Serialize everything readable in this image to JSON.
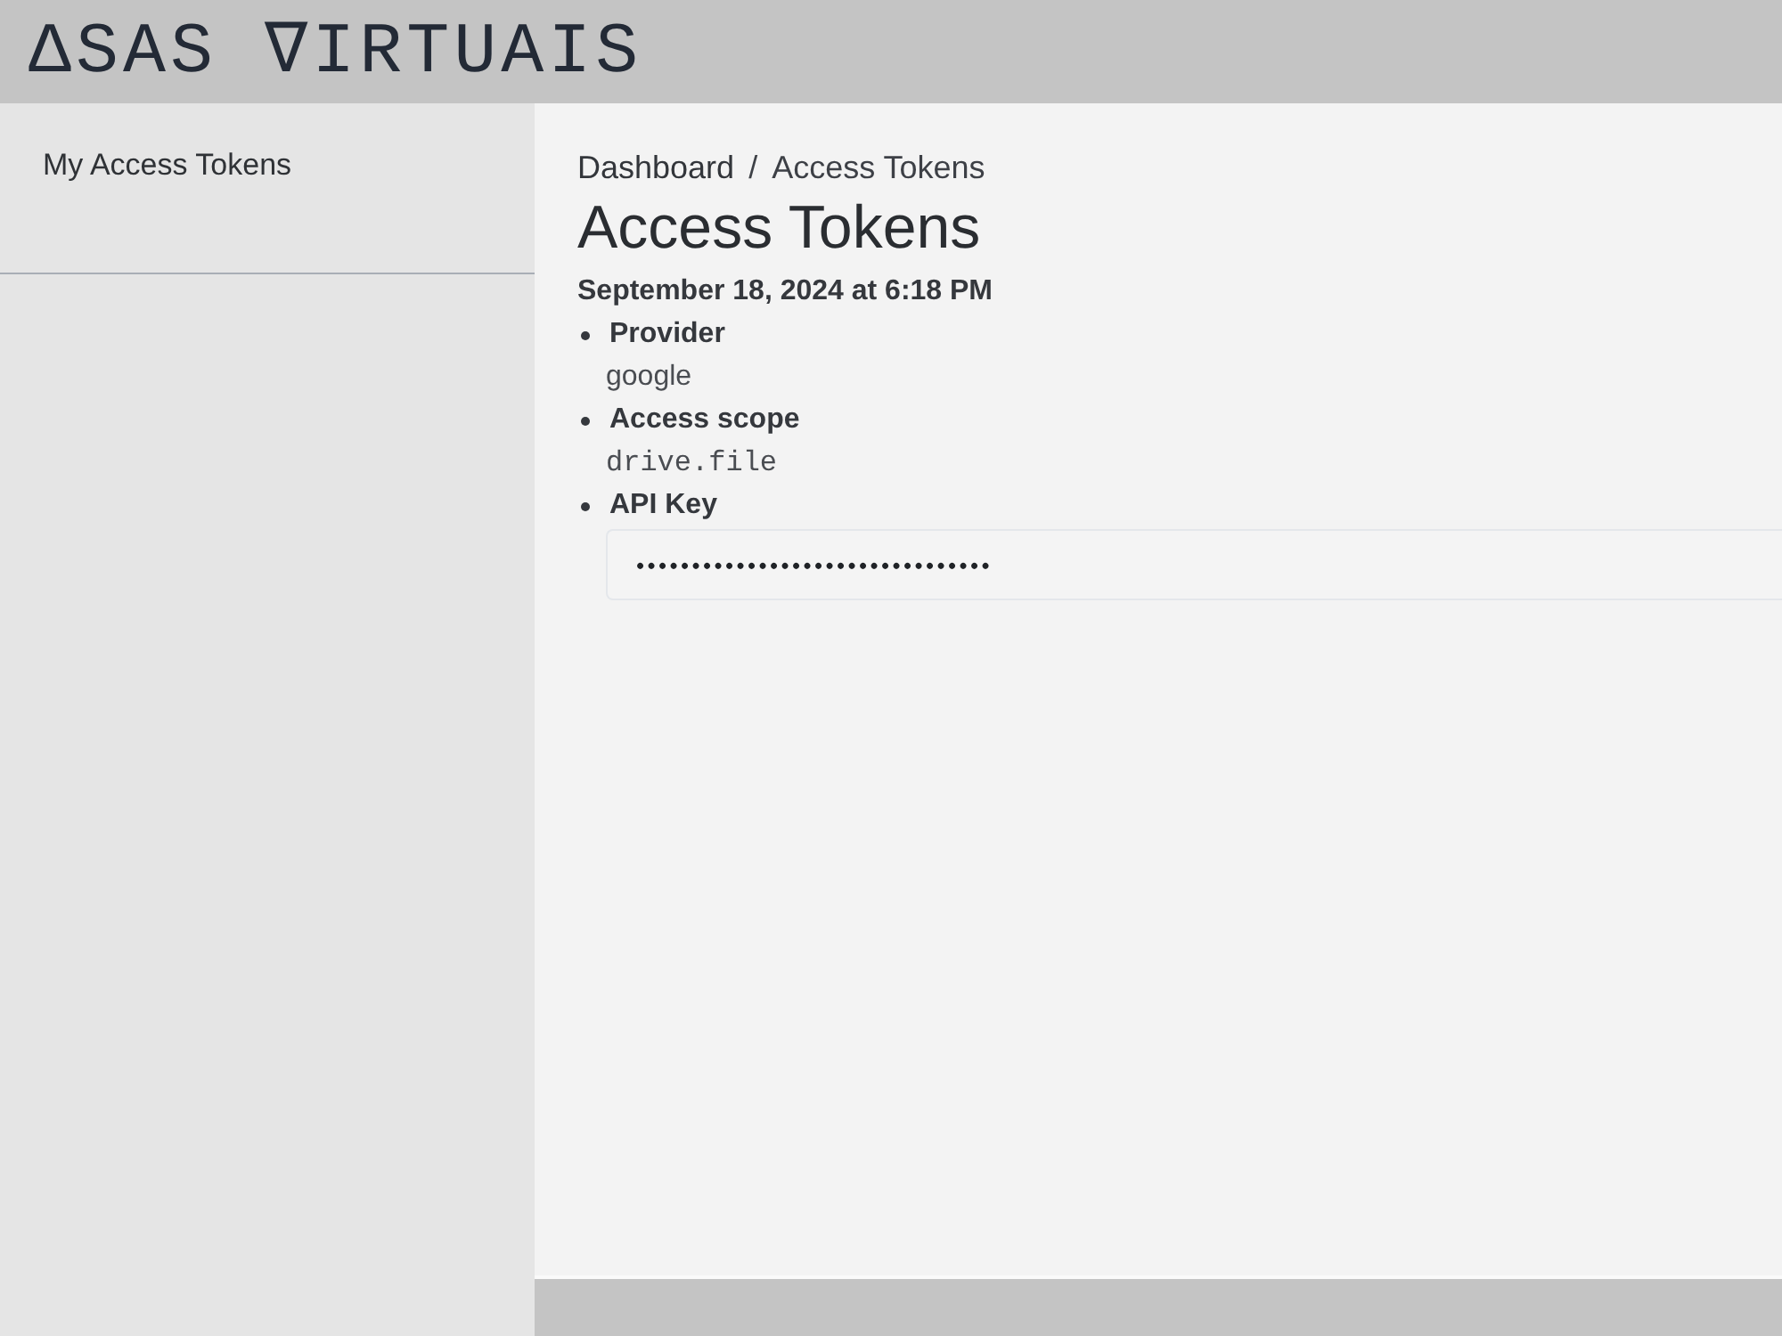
{
  "header": {
    "logo": "ΔSAS ∇IRTUAIS"
  },
  "sidebar": {
    "items": [
      {
        "label": "My Access Tokens"
      }
    ]
  },
  "breadcrumb": {
    "items": [
      "Dashboard",
      "Access Tokens"
    ],
    "separator": "/"
  },
  "title": "Access Tokens",
  "token": {
    "created": "September 18, 2024 at 6:18 PM",
    "fields": [
      {
        "label": "Provider",
        "value": "google",
        "kind": "text"
      },
      {
        "label": "Access scope",
        "value": "drive.file",
        "kind": "code"
      },
      {
        "label": "API Key",
        "value": "••••••••••••••••••••••••••••••••",
        "kind": "secret"
      }
    ]
  }
}
